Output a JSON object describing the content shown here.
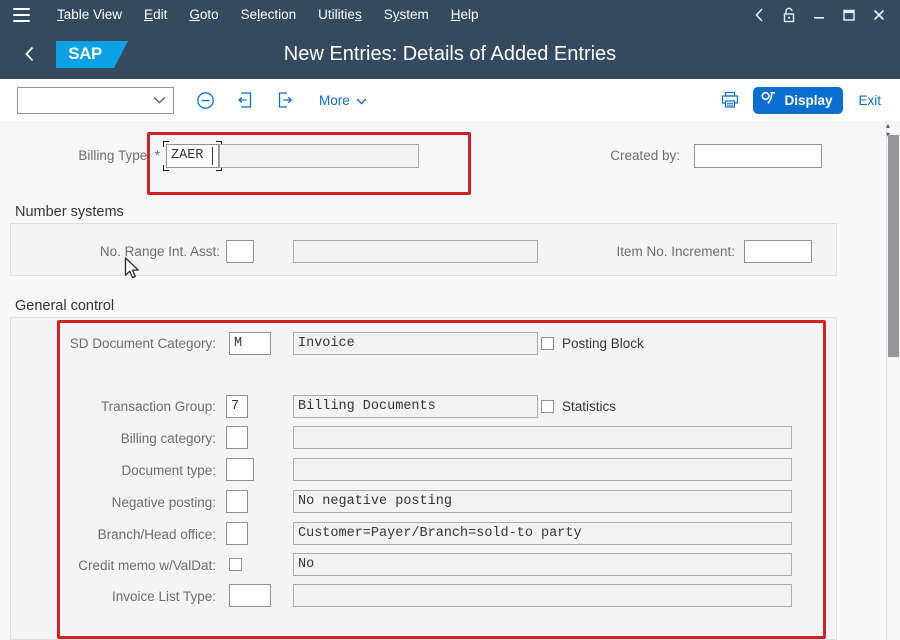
{
  "menubar": {
    "hamburger_icon": "hamburger-menu-icon",
    "items": [
      {
        "label": "Table View",
        "accel": "T"
      },
      {
        "label": "Edit",
        "accel": "E"
      },
      {
        "label": "Goto",
        "accel": "G"
      },
      {
        "label": "Selection",
        "accel": "l"
      },
      {
        "label": "Utilities",
        "accel": "s"
      },
      {
        "label": "System",
        "accel": "y"
      },
      {
        "label": "Help",
        "accel": "H"
      }
    ],
    "window_controls": [
      {
        "name": "back-chevron-icon"
      },
      {
        "name": "lock-icon"
      },
      {
        "name": "minimize-icon"
      },
      {
        "name": "maximize-icon"
      },
      {
        "name": "close-icon"
      }
    ]
  },
  "shellbar": {
    "back_icon": "back-arrow-icon",
    "logo_text": "SAP",
    "title": "New Entries: Details of Added Entries"
  },
  "toolbar": {
    "select_value": "",
    "select_icon": "chevron-down-icon",
    "delete_icon": "minus-circle-icon",
    "prev_entry_icon": "previous-entry-icon",
    "next_entry_icon": "next-entry-icon",
    "more_label": "More",
    "more_icon": "chevron-down-icon",
    "print_icon": "printer-icon",
    "display_label": "Display",
    "display_icon": "display-change-icon",
    "display_color": "#0a6ed1",
    "exit_label": "Exit"
  },
  "form": {
    "billing_type": {
      "label": "Billing Type:",
      "required_mark": "*",
      "value": "ZAER",
      "desc_value": "",
      "highlight_color": "#d62027"
    },
    "created_by": {
      "label": "Created by:",
      "value": ""
    },
    "number_systems": {
      "title": "Number systems",
      "no_range_int_asst": {
        "label": "No. Range Int. Asst:",
        "value": "",
        "desc_value": ""
      },
      "item_no_increment": {
        "label": "Item No. Increment:",
        "value": ""
      }
    },
    "general_control": {
      "title": "General control",
      "highlight_color": "#d62027",
      "rows": [
        {
          "label": "SD Document Category:",
          "code": "M",
          "desc": "Invoice"
        },
        {
          "label": "Transaction Group:",
          "code": "7",
          "desc": "Billing Documents"
        },
        {
          "label": "Billing category:",
          "code": "",
          "desc": ""
        },
        {
          "label": "Document type:",
          "code": "",
          "desc": ""
        },
        {
          "label": "Negative posting:",
          "code": "",
          "desc": "No negative posting"
        },
        {
          "label": "Branch/Head office:",
          "code": "",
          "desc": "Customer=Payer/Branch=sold-to party"
        },
        {
          "label": "Credit memo w/ValDat:",
          "code": "",
          "desc": "No"
        },
        {
          "label": "Invoice List Type:",
          "code": "",
          "desc": ""
        }
      ],
      "checkboxes": [
        {
          "label": "Posting Block",
          "checked": false
        },
        {
          "label": "Statistics",
          "checked": false
        }
      ]
    }
  },
  "scrollbar": {
    "up_icon": "scroll-up-icon",
    "down_icon": "scroll-down-icon"
  },
  "cursor": {
    "icon": "mouse-pointer-icon"
  }
}
